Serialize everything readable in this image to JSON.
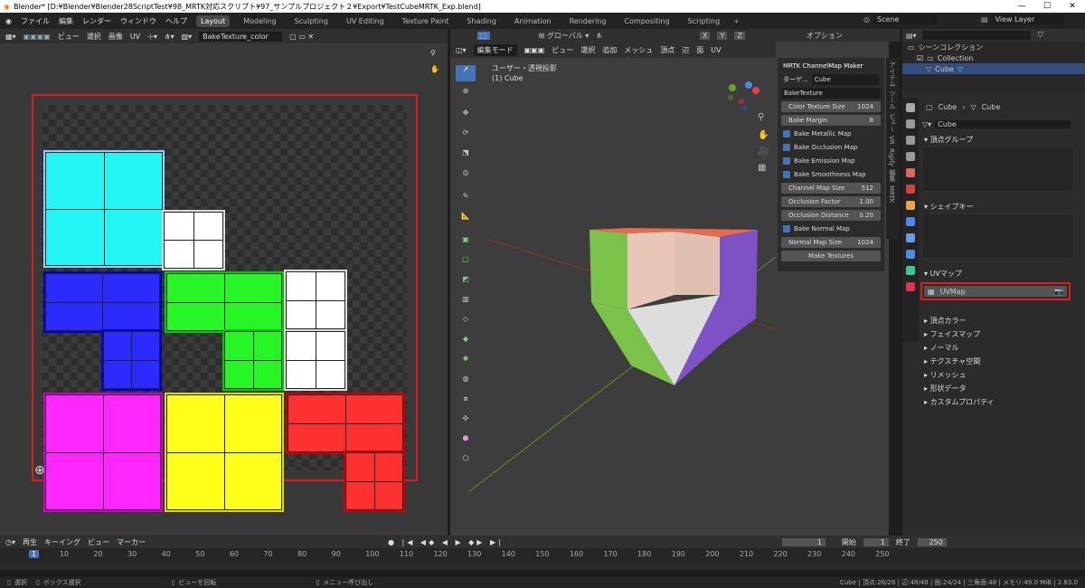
{
  "window": {
    "title": "Blender* [D:¥Blender¥Blender28ScriptTest¥98_MRTK対応スクリプト¥97_サンプルプロジェクト２¥Export¥TestCubeMRTK_Exp.blend]"
  },
  "topbar": {
    "menus": [
      "ファイル",
      "編集",
      "レンダー",
      "ウィンドウ",
      "ヘルプ"
    ],
    "workspaces": [
      "Layout",
      "Modeling",
      "Sculpting",
      "UV Editing",
      "Texture Paint",
      "Shading",
      "Animation",
      "Rendering",
      "Compositing",
      "Scripting"
    ],
    "active_workspace": "Layout",
    "scene": "Scene",
    "view_layer": "View Layer"
  },
  "uv_editor": {
    "menus": [
      "ビュー",
      "選択",
      "画像",
      "UV"
    ],
    "image_name": "BakeTexture_color",
    "tiles": [
      {
        "color": "#24f5f5",
        "outline": "#9cf"
      },
      {
        "color": "#ffffff",
        "outline": "#ddd"
      },
      {
        "color": "#2b2bff",
        "outline": "#00c"
      },
      {
        "color": "#26f526",
        "outline": "#0c0"
      },
      {
        "color": "#ffffff",
        "outline": "#ddd"
      },
      {
        "color": "#ff26ff",
        "outline": "#c0c"
      },
      {
        "color": "#ffff1a",
        "outline": "#dd0"
      },
      {
        "color": "#ff3030",
        "outline": "#c00"
      }
    ]
  },
  "viewport": {
    "mode": "編集モード",
    "menus": [
      "ビュー",
      "選択",
      "追加",
      "メッシュ",
      "頂点",
      "辺",
      "面",
      "UV"
    ],
    "orientation": "グローバル",
    "options_label": "オプション",
    "axes": [
      "X",
      "Y",
      "Z"
    ],
    "view_name": "ユーザー・透視投影",
    "object_name": "(1) Cube"
  },
  "mrtk_panel": {
    "title": "MRTK ChannelMap Maker",
    "target_label": "ターゲ...",
    "target_value": "Cube",
    "bake_texture": "BakeTexture",
    "fields": [
      {
        "label": "Color Texture Size",
        "value": "1024"
      },
      {
        "label": "Bake Margin",
        "value": "8"
      }
    ],
    "checks": [
      "Bake Metallic Map",
      "Bake Occlusion Map",
      "Bake Emission Map",
      "Bake Smoothness Map"
    ],
    "fields2": [
      {
        "label": "Channel Map Size",
        "value": "512"
      },
      {
        "label": "Occlusion Factor",
        "value": "1.00"
      },
      {
        "label": "Occlusion Distance",
        "value": "0.20"
      }
    ],
    "check_normal": "Bake Normal Map",
    "normal_size": {
      "label": "Normal Map Size",
      "value": "1024"
    },
    "make_button": "Make Textures"
  },
  "side_tabs": [
    "アイテム",
    "ツール",
    "ビュー",
    "VR",
    "Rigify",
    "編集",
    "MRTK"
  ],
  "outliner": {
    "root": "シーンコレクション",
    "collection": "Collection",
    "object": "Cube"
  },
  "properties": {
    "object": "Cube",
    "mesh": "Cube",
    "data_name": "Cube",
    "vertex_groups": "頂点グループ",
    "shape_keys": "シェイプキー",
    "uv_maps": "UVマップ",
    "uv_map_item": "UVMap",
    "collapsed": [
      "頂点カラー",
      "フェイスマップ",
      "ノーマル",
      "テクスチャ空間",
      "リメッシュ",
      "形状データ",
      "カスタムプロパティ"
    ]
  },
  "timeline": {
    "menus": [
      "再生",
      "キーイング",
      "ビュー",
      "マーカー"
    ],
    "current_frame": "1",
    "start_label": "開始",
    "start": "1",
    "end_label": "終了",
    "end": "250",
    "ticks": [
      "1",
      "10",
      "20",
      "30",
      "40",
      "50",
      "60",
      "70",
      "80",
      "90",
      "100",
      "110",
      "120",
      "130",
      "140",
      "150",
      "160",
      "170",
      "180",
      "190",
      "200",
      "210",
      "220",
      "230",
      "240",
      "250"
    ]
  },
  "status": {
    "left": [
      "選択",
      "ボックス選択",
      "ビューを回転",
      "メニュー呼び出し"
    ],
    "right": "Cube | 頂点:26/26 | 辺:48/48 | 面:24/24 | 三角面:48 | メモリ:49.0 MiB | 2.83.0"
  }
}
